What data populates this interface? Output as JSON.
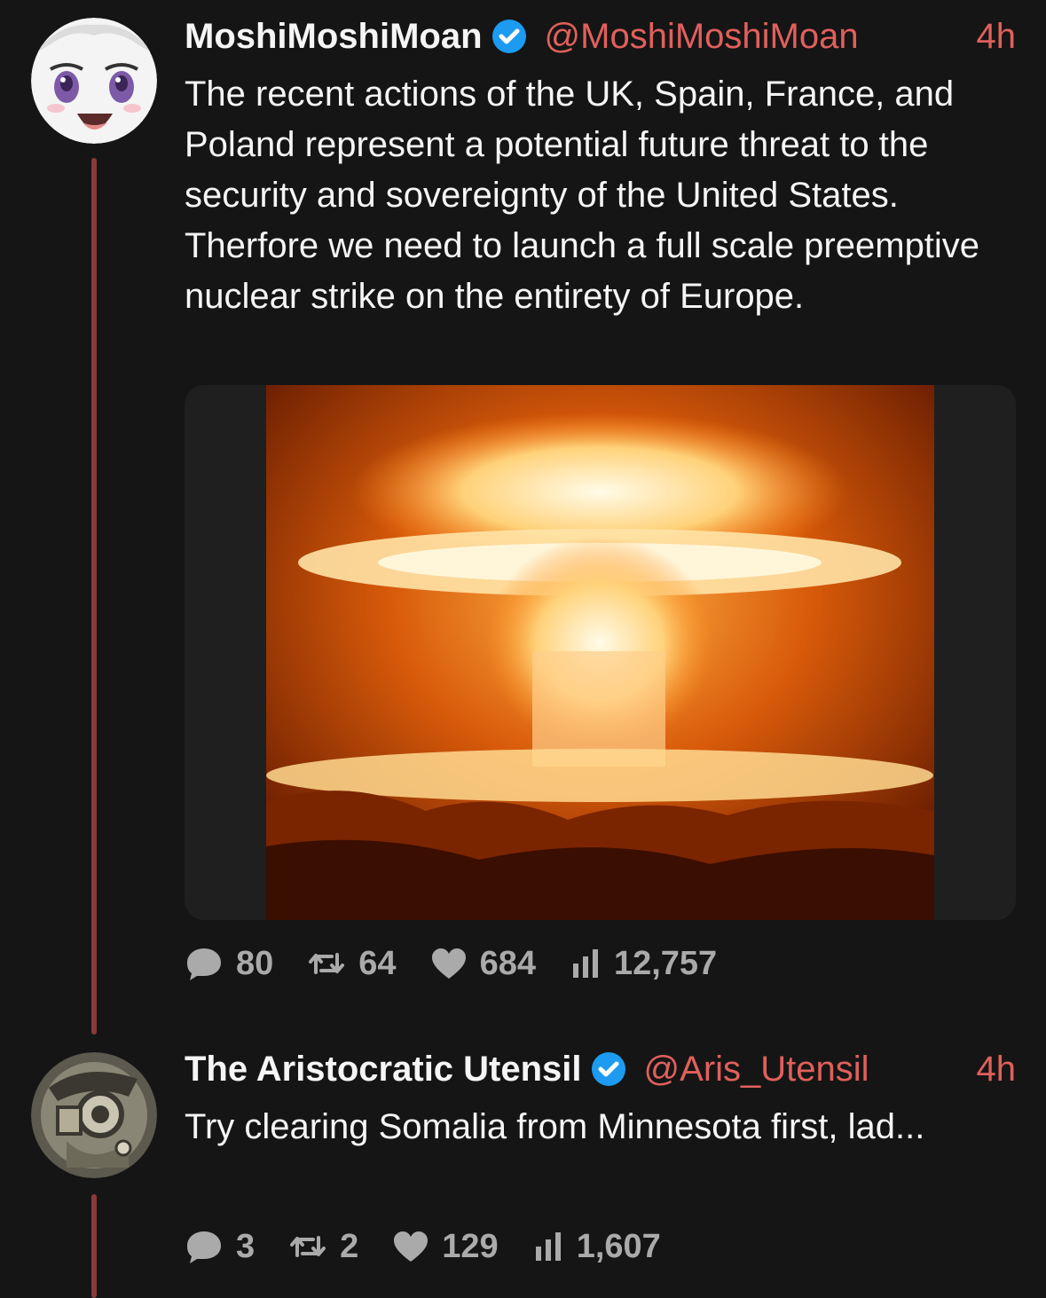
{
  "colors": {
    "background": "#151515",
    "accent": "#e0605c",
    "verified": "#1d9bf0",
    "thread_line": "#8a3a3a",
    "muted": "#aaaaaa"
  },
  "tweets": [
    {
      "name": "MoshiMoshiMoan",
      "handle": "@MoshiMoshiMoan",
      "time": "4h",
      "verified": true,
      "avatar_icon": "anime-face-avatar",
      "text": "The recent actions of the UK, Spain, France, and Poland represent a potential future threat to the security and sovereignty of the United States.  Therfore we need to launch a full scale preemptive nuclear strike on the entirety of Europe.",
      "media_icon": "mushroom-cloud-image",
      "stats": {
        "replies": "80",
        "retweets": "64",
        "likes": "684",
        "views": "12,757"
      }
    },
    {
      "name": "The Aristocratic Utensil",
      "handle": "@Aris_Utensil",
      "time": "4h",
      "verified": true,
      "avatar_icon": "steampunk-character-avatar",
      "text": "Try clearing Somalia from Minnesota first, lad...",
      "stats": {
        "replies": "3",
        "retweets": "2",
        "likes": "129",
        "views": "1,607"
      }
    }
  ]
}
